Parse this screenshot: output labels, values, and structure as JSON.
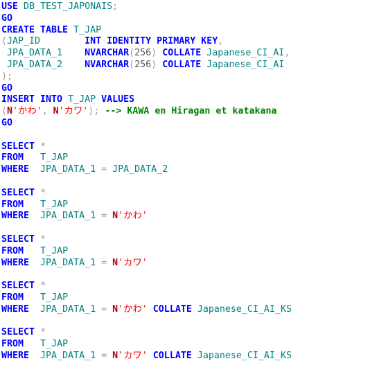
{
  "editor": {
    "name": "sql-code-listing",
    "language": "T-SQL",
    "background": "#ffffff",
    "colors": {
      "keyword": "#0000ff",
      "identifier": "#008080",
      "string": "#ff0000",
      "string_prefix": "#b00020",
      "comment": "#008000",
      "punctuation": "#9a9a9a",
      "number": "#555555"
    }
  },
  "code": {
    "lines": [
      {
        "n": 1,
        "text": "USE DB_TEST_JAPONAIS;",
        "tokens": [
          {
            "t": "USE",
            "c": "kw"
          },
          {
            "t": " ",
            "c": "plain"
          },
          {
            "t": "DB_TEST_JAPONAIS",
            "c": "id"
          },
          {
            "t": ";",
            "c": "pun"
          }
        ]
      },
      {
        "n": 2,
        "text": "GO",
        "tokens": [
          {
            "t": "GO",
            "c": "kw"
          }
        ]
      },
      {
        "n": 3,
        "text": "CREATE TABLE T_JAP",
        "tokens": [
          {
            "t": "CREATE TABLE",
            "c": "kw"
          },
          {
            "t": " ",
            "c": "plain"
          },
          {
            "t": "T_JAP",
            "c": "id"
          }
        ]
      },
      {
        "n": 4,
        "text": "(JAP_ID        INT IDENTITY PRIMARY KEY,",
        "tokens": [
          {
            "t": "(",
            "c": "pun"
          },
          {
            "t": "JAP_ID",
            "c": "id"
          },
          {
            "t": "        ",
            "c": "plain"
          },
          {
            "t": "INT IDENTITY PRIMARY KEY",
            "c": "kw"
          },
          {
            "t": ",",
            "c": "pun"
          }
        ]
      },
      {
        "n": 5,
        "text": " JPA_DATA_1    NVARCHAR(256) COLLATE Japanese_CI_AI,",
        "tokens": [
          {
            "t": " ",
            "c": "plain"
          },
          {
            "t": "JPA_DATA_1",
            "c": "id"
          },
          {
            "t": "    ",
            "c": "plain"
          },
          {
            "t": "NVARCHAR",
            "c": "kw"
          },
          {
            "t": "(",
            "c": "pun"
          },
          {
            "t": "256",
            "c": "num"
          },
          {
            "t": ")",
            "c": "pun"
          },
          {
            "t": " ",
            "c": "plain"
          },
          {
            "t": "COLLATE",
            "c": "kw"
          },
          {
            "t": " ",
            "c": "plain"
          },
          {
            "t": "Japanese_CI_AI",
            "c": "id"
          },
          {
            "t": ",",
            "c": "pun"
          }
        ]
      },
      {
        "n": 6,
        "text": " JPA_DATA_2    NVARCHAR(256) COLLATE Japanese_CI_AI",
        "tokens": [
          {
            "t": " ",
            "c": "plain"
          },
          {
            "t": "JPA_DATA_2",
            "c": "id"
          },
          {
            "t": "    ",
            "c": "plain"
          },
          {
            "t": "NVARCHAR",
            "c": "kw"
          },
          {
            "t": "(",
            "c": "pun"
          },
          {
            "t": "256",
            "c": "num"
          },
          {
            "t": ")",
            "c": "pun"
          },
          {
            "t": " ",
            "c": "plain"
          },
          {
            "t": "COLLATE",
            "c": "kw"
          },
          {
            "t": " ",
            "c": "plain"
          },
          {
            "t": "Japanese_CI_AI",
            "c": "id"
          }
        ]
      },
      {
        "n": 7,
        "text": ");",
        "tokens": [
          {
            "t": ");",
            "c": "pun"
          }
        ]
      },
      {
        "n": 8,
        "text": "GO",
        "tokens": [
          {
            "t": "GO",
            "c": "kw"
          }
        ]
      },
      {
        "n": 9,
        "text": "INSERT INTO T_JAP VALUES",
        "tokens": [
          {
            "t": "INSERT INTO",
            "c": "kw"
          },
          {
            "t": " ",
            "c": "plain"
          },
          {
            "t": "T_JAP",
            "c": "id"
          },
          {
            "t": " ",
            "c": "plain"
          },
          {
            "t": "VALUES",
            "c": "kw"
          }
        ]
      },
      {
        "n": 10,
        "text": "(N'かわ', N'カワ'); --> KAWA en Hiragan et katakana",
        "tokens": [
          {
            "t": "(",
            "c": "pun"
          },
          {
            "t": "N",
            "c": "npfx"
          },
          {
            "t": "'かわ'",
            "c": "str"
          },
          {
            "t": ", ",
            "c": "pun"
          },
          {
            "t": "N",
            "c": "npfx"
          },
          {
            "t": "'カワ'",
            "c": "str"
          },
          {
            "t": "); ",
            "c": "pun"
          },
          {
            "t": "--> KAWA en Hiragan et katakana",
            "c": "cmt"
          }
        ]
      },
      {
        "n": 11,
        "text": "GO",
        "tokens": [
          {
            "t": "GO",
            "c": "kw"
          }
        ]
      },
      {
        "n": 12,
        "text": "",
        "tokens": []
      },
      {
        "n": 13,
        "text": "SELECT *",
        "tokens": [
          {
            "t": "SELECT",
            "c": "kw"
          },
          {
            "t": " ",
            "c": "plain"
          },
          {
            "t": "*",
            "c": "star"
          }
        ]
      },
      {
        "n": 14,
        "text": "FROM   T_JAP",
        "tokens": [
          {
            "t": "FROM",
            "c": "kw"
          },
          {
            "t": "   ",
            "c": "plain"
          },
          {
            "t": "T_JAP",
            "c": "id"
          }
        ]
      },
      {
        "n": 15,
        "text": "WHERE  JPA_DATA_1 = JPA_DATA_2",
        "tokens": [
          {
            "t": "WHERE",
            "c": "kw"
          },
          {
            "t": "  ",
            "c": "plain"
          },
          {
            "t": "JPA_DATA_1",
            "c": "id"
          },
          {
            "t": " ",
            "c": "plain"
          },
          {
            "t": "=",
            "c": "pun"
          },
          {
            "t": " ",
            "c": "plain"
          },
          {
            "t": "JPA_DATA_2",
            "c": "id"
          }
        ]
      },
      {
        "n": 16,
        "text": "",
        "tokens": []
      },
      {
        "n": 17,
        "text": "SELECT *",
        "tokens": [
          {
            "t": "SELECT",
            "c": "kw"
          },
          {
            "t": " ",
            "c": "plain"
          },
          {
            "t": "*",
            "c": "star"
          }
        ]
      },
      {
        "n": 18,
        "text": "FROM   T_JAP",
        "tokens": [
          {
            "t": "FROM",
            "c": "kw"
          },
          {
            "t": "   ",
            "c": "plain"
          },
          {
            "t": "T_JAP",
            "c": "id"
          }
        ]
      },
      {
        "n": 19,
        "text": "WHERE  JPA_DATA_1 = N'かわ'",
        "tokens": [
          {
            "t": "WHERE",
            "c": "kw"
          },
          {
            "t": "  ",
            "c": "plain"
          },
          {
            "t": "JPA_DATA_1",
            "c": "id"
          },
          {
            "t": " ",
            "c": "plain"
          },
          {
            "t": "=",
            "c": "pun"
          },
          {
            "t": " ",
            "c": "plain"
          },
          {
            "t": "N",
            "c": "npfx"
          },
          {
            "t": "'かわ'",
            "c": "str"
          }
        ]
      },
      {
        "n": 20,
        "text": "",
        "tokens": []
      },
      {
        "n": 21,
        "text": "SELECT *",
        "tokens": [
          {
            "t": "SELECT",
            "c": "kw"
          },
          {
            "t": " ",
            "c": "plain"
          },
          {
            "t": "*",
            "c": "star"
          }
        ]
      },
      {
        "n": 22,
        "text": "FROM   T_JAP",
        "tokens": [
          {
            "t": "FROM",
            "c": "kw"
          },
          {
            "t": "   ",
            "c": "plain"
          },
          {
            "t": "T_JAP",
            "c": "id"
          }
        ]
      },
      {
        "n": 23,
        "text": "WHERE  JPA_DATA_1 = N'カワ'",
        "tokens": [
          {
            "t": "WHERE",
            "c": "kw"
          },
          {
            "t": "  ",
            "c": "plain"
          },
          {
            "t": "JPA_DATA_1",
            "c": "id"
          },
          {
            "t": " ",
            "c": "plain"
          },
          {
            "t": "=",
            "c": "pun"
          },
          {
            "t": " ",
            "c": "plain"
          },
          {
            "t": "N",
            "c": "npfx"
          },
          {
            "t": "'カワ'",
            "c": "str"
          }
        ]
      },
      {
        "n": 24,
        "text": "",
        "tokens": []
      },
      {
        "n": 25,
        "text": "SELECT *",
        "tokens": [
          {
            "t": "SELECT",
            "c": "kw"
          },
          {
            "t": " ",
            "c": "plain"
          },
          {
            "t": "*",
            "c": "star"
          }
        ]
      },
      {
        "n": 26,
        "text": "FROM   T_JAP",
        "tokens": [
          {
            "t": "FROM",
            "c": "kw"
          },
          {
            "t": "   ",
            "c": "plain"
          },
          {
            "t": "T_JAP",
            "c": "id"
          }
        ]
      },
      {
        "n": 27,
        "text": "WHERE  JPA_DATA_1 = N'かわ' COLLATE Japanese_CI_AI_KS",
        "tokens": [
          {
            "t": "WHERE",
            "c": "kw"
          },
          {
            "t": "  ",
            "c": "plain"
          },
          {
            "t": "JPA_DATA_1",
            "c": "id"
          },
          {
            "t": " ",
            "c": "plain"
          },
          {
            "t": "=",
            "c": "pun"
          },
          {
            "t": " ",
            "c": "plain"
          },
          {
            "t": "N",
            "c": "npfx"
          },
          {
            "t": "'かわ'",
            "c": "str"
          },
          {
            "t": " ",
            "c": "plain"
          },
          {
            "t": "COLLATE",
            "c": "kw"
          },
          {
            "t": " ",
            "c": "plain"
          },
          {
            "t": "Japanese_CI_AI_KS",
            "c": "id"
          }
        ]
      },
      {
        "n": 28,
        "text": "",
        "tokens": []
      },
      {
        "n": 29,
        "text": "SELECT *",
        "tokens": [
          {
            "t": "SELECT",
            "c": "kw"
          },
          {
            "t": " ",
            "c": "plain"
          },
          {
            "t": "*",
            "c": "star"
          }
        ]
      },
      {
        "n": 30,
        "text": "FROM   T_JAP",
        "tokens": [
          {
            "t": "FROM",
            "c": "kw"
          },
          {
            "t": "   ",
            "c": "plain"
          },
          {
            "t": "T_JAP",
            "c": "id"
          }
        ]
      },
      {
        "n": 31,
        "text": "WHERE  JPA_DATA_1 = N'カワ' COLLATE Japanese_CI_AI_KS",
        "tokens": [
          {
            "t": "WHERE",
            "c": "kw"
          },
          {
            "t": "  ",
            "c": "plain"
          },
          {
            "t": "JPA_DATA_1",
            "c": "id"
          },
          {
            "t": " ",
            "c": "plain"
          },
          {
            "t": "=",
            "c": "pun"
          },
          {
            "t": " ",
            "c": "plain"
          },
          {
            "t": "N",
            "c": "npfx"
          },
          {
            "t": "'カワ'",
            "c": "str"
          },
          {
            "t": " ",
            "c": "plain"
          },
          {
            "t": "COLLATE",
            "c": "kw"
          },
          {
            "t": " ",
            "c": "plain"
          },
          {
            "t": "Japanese_CI_AI_KS",
            "c": "id"
          }
        ]
      }
    ]
  }
}
